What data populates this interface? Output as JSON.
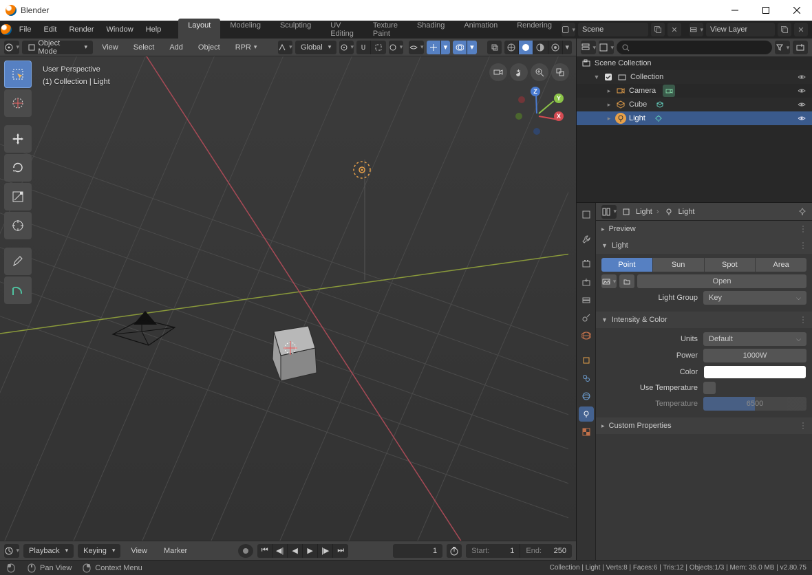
{
  "window": {
    "title": "Blender"
  },
  "menubar": [
    "File",
    "Edit",
    "Render",
    "Window",
    "Help"
  ],
  "workspace_tabs": [
    "Layout",
    "Modeling",
    "Sculpting",
    "UV Editing",
    "Texture Paint",
    "Shading",
    "Animation",
    "Rendering"
  ],
  "workspace_active": 0,
  "scene_field": "Scene",
  "view_layer_field": "View Layer",
  "viewport": {
    "mode": "Object Mode",
    "menu": [
      "View",
      "Select",
      "Add",
      "Object",
      "RPR"
    ],
    "orientation": "Global",
    "info_line1": "User Perspective",
    "info_line2": "(1)  Collection | Light"
  },
  "timeline": {
    "menu": [
      "Playback",
      "Keying",
      "View",
      "Marker"
    ],
    "frame": "1",
    "start_label": "Start:",
    "start": "1",
    "end_label": "End:",
    "end": "250"
  },
  "statusbar": {
    "hint_pan": "Pan View",
    "hint_context": "Context Menu",
    "right": "Collection | Light | Verts:8 | Faces:6 | Tris:12 | Objects:1/3 | Mem: 35.0 MB | v2.80.75"
  },
  "outliner": {
    "root": "Scene Collection",
    "collection": "Collection",
    "items": [
      {
        "name": "Camera",
        "icon": "camera-icon"
      },
      {
        "name": "Cube",
        "icon": "mesh-icon"
      },
      {
        "name": "Light",
        "icon": "light-icon"
      }
    ],
    "selected": 2
  },
  "properties": {
    "breadcrumb_object": "Light",
    "breadcrumb_data": "Light",
    "preview_label": "Preview",
    "light_label": "Light",
    "light_types": [
      "Point",
      "Sun",
      "Spot",
      "Area"
    ],
    "light_type_active": 0,
    "open_button": "Open",
    "light_group_label": "Light Group",
    "light_group_value": "Key",
    "intensity_header": "Intensity & Color",
    "units_label": "Units",
    "units_value": "Default",
    "power_label": "Power",
    "power_value": "1000W",
    "color_label": "Color",
    "use_temp_label": "Use Temperature",
    "temperature_label": "Temperature",
    "temperature_value": "6500",
    "custom_props_label": "Custom Properties"
  }
}
